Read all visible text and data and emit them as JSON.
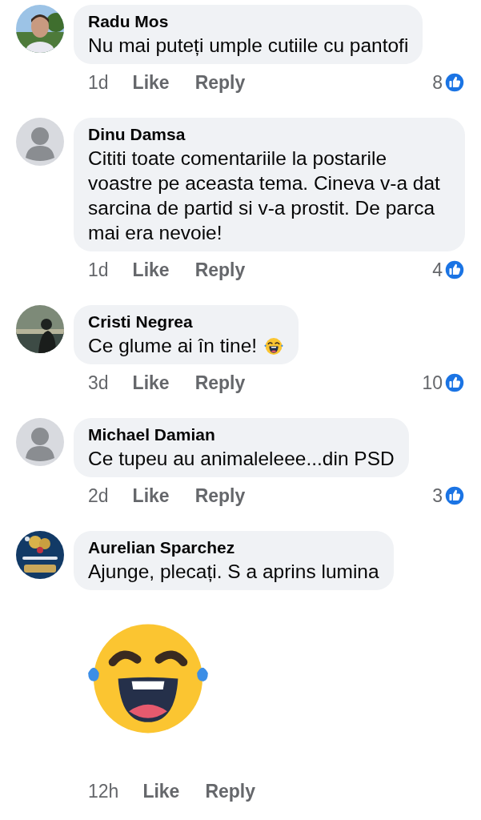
{
  "comments": [
    {
      "author": "Radu Mos",
      "text": "Nu mai puteți umple cutiile cu pantofi",
      "emoji": false,
      "sticker": false,
      "time": "1d",
      "like": "Like",
      "reply": "Reply",
      "reactions": "8"
    },
    {
      "author": "Dinu Damsa",
      "avatar": {
        "kind": "default"
      },
      "text": "Cititi toate comentariile la postarile voastre pe aceasta tema. Cineva v-a dat sarcina de partid si v-a prostit. De parca mai era nevoie!",
      "emoji": false,
      "sticker": false,
      "time": "1d",
      "like": "Like",
      "reply": "Reply",
      "reactions": "4"
    },
    {
      "author": "Cristi Negrea",
      "text": "Ce glume ai în tine!",
      "emoji": true,
      "sticker": false,
      "time": "3d",
      "like": "Like",
      "reply": "Reply",
      "reactions": "10"
    },
    {
      "author": "Michael Damian",
      "avatar": {
        "kind": "default"
      },
      "text": "Ce tupeu au animaleleee...din PSD",
      "emoji": false,
      "sticker": false,
      "time": "2d",
      "like": "Like",
      "reply": "Reply",
      "reactions": "3"
    },
    {
      "author": "Aurelian Sparchez",
      "text": "Ajunge, plecați. S a aprins lumina",
      "emoji": false,
      "sticker": true,
      "time": "12h",
      "like": "Like",
      "reply": "Reply"
    }
  ]
}
